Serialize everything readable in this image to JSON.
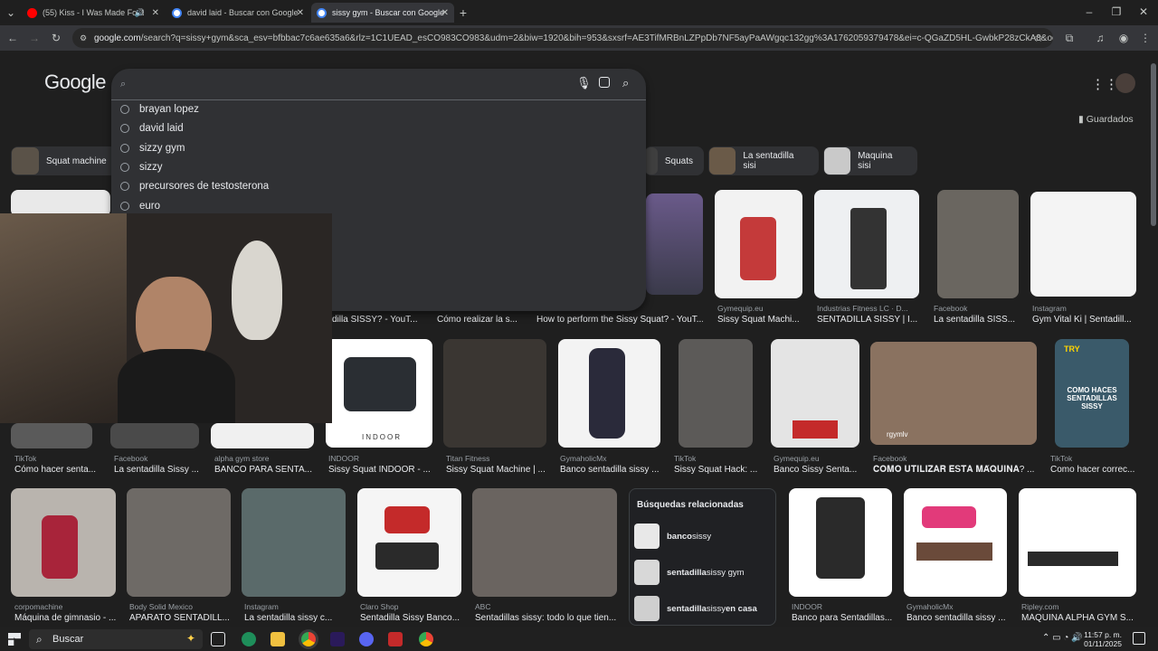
{
  "tabs": [
    {
      "title": "(55) Kiss - I Was Made For L",
      "favicon_color": "#ff0000"
    },
    {
      "title": "david laid - Buscar con Google",
      "favicon_color": "#c4c7c5"
    },
    {
      "title": "sissy gym - Buscar con Google",
      "favicon_color": "#c4c7c5"
    }
  ],
  "address": {
    "domain": "google.com",
    "path": "/search?q=sissy+gym&sca_esv=bfbbac7c6ae635a6&rlz=1C1UEAD_esCO983CO983&udm=2&biw=1920&bih=953&sxsrf=AE3TifMRBnLZPpDb7NF5ayPaAWgqc132gg%3A1762059379478&ei=c-QGaZD5HL-GwbkP28zCkA8&oq=sissy&gs_..."
  },
  "logo": "Google",
  "search": {
    "value": "",
    "suggestions": [
      "brayan lopez",
      "david laid",
      "sizzy gym",
      "sizzy",
      "precursores de testosterona",
      "euro"
    ]
  },
  "saved_label": "Guardados",
  "chips": [
    {
      "label": "Squat machine",
      "color": "#5a5248"
    },
    {
      "label": "Squats",
      "color": "#3f3f3f"
    },
    {
      "label": "La sentadilla sisi",
      "color": "#6a5a48"
    },
    {
      "label": "Maquina sisi",
      "color": "#c9c9c9"
    }
  ],
  "row1": [
    {
      "source": "Gymequip.eu",
      "caption": "Sissy Squat Machi..."
    },
    {
      "source": "Industrias Fitness LC · D...",
      "caption": "SENTADILLA SISSY | I..."
    },
    {
      "source": "Facebook",
      "caption": "La sentadilla SISS..."
    },
    {
      "source": "Instagram",
      "caption": "Gym Vital Ki | Sentadill..."
    }
  ],
  "row1_partial": [
    "dilla SISSY? - YouT...",
    "Cómo realizar la s...",
    "How to perform the Sissy Squat? - YouT..."
  ],
  "row2": [
    {
      "source": "TikTok",
      "caption": "Cómo hacer senta..."
    },
    {
      "source": "Facebook",
      "caption": "La sentadilla Sissy ..."
    },
    {
      "source": "alpha gym store",
      "caption": "BANCO PARA SENTA..."
    },
    {
      "source": "INDOOR",
      "caption": "Sissy Squat INDOOR - ..."
    },
    {
      "source": "Titan Fitness",
      "caption": "Sissy Squat Machine | ..."
    },
    {
      "source": "GymaholicMx",
      "caption": "Banco sentadilla sissy ..."
    },
    {
      "source": "TikTok",
      "caption": "Sissy Squat Hack: ..."
    },
    {
      "source": "Gymequip.eu",
      "caption": "Banco Sissy Senta..."
    },
    {
      "source": "Facebook",
      "caption": "𝐂𝐎𝐌𝐎 𝐔𝐓𝐈𝐋𝐈𝐙𝐀𝐑 𝐄𝐒𝐓𝐀 𝐌𝐀́𝐐𝐔𝐈𝐍𝐀? ..."
    },
    {
      "source": "TikTok",
      "caption": "Como hacer correc..."
    }
  ],
  "row2_overlay_text": {
    "indoor_logo": "INDOOR",
    "video_label": "rgymlv",
    "try_label": "TRY",
    "howto": "COMO HACES SENTADILLAS SISSY"
  },
  "row3": [
    {
      "source": "corpomachine",
      "caption": "Máquina de gimnasio - ..."
    },
    {
      "source": "Body Solid Mexico",
      "caption": "APARATO SENTADILL..."
    },
    {
      "source": "Instagram",
      "caption": "La sentadilla sissy c..."
    },
    {
      "source": "Claro Shop",
      "caption": "Sentadilla Sissy Banco..."
    },
    {
      "source": "ABC",
      "caption": "Sentadillas sissy: todo lo que tien..."
    },
    {
      "source": "INDOOR",
      "caption": "Banco para Sentadillas..."
    },
    {
      "source": "GymaholicMx",
      "caption": "Banco sentadilla sissy ..."
    },
    {
      "source": "Ripley.com",
      "caption": "MÁQUINA ALPHA GYM S..."
    }
  ],
  "related": {
    "title": "Búsquedas relacionadas",
    "items": [
      {
        "bold_pre": "banco",
        "normal": " sissy",
        "bold_post": ""
      },
      {
        "bold_pre": "sentadilla",
        "normal": " sissy gym",
        "bold_post": ""
      },
      {
        "bold_pre": "sentadilla",
        "normal": " sissy ",
        "bold_post": "en casa"
      }
    ]
  },
  "taskbar": {
    "search_placeholder": "Buscar",
    "time": "11:57 p. m.",
    "date": "01/11/2025"
  }
}
